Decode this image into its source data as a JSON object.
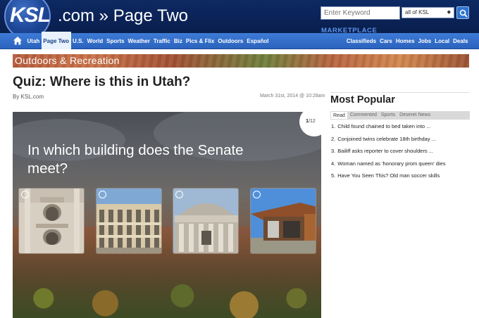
{
  "header": {
    "logo_main": "KSL",
    "logo_rest": ".com » Page Two",
    "search_placeholder": "Enter Keyword",
    "search_scope": "all of KSL",
    "marketplace_label": "MARKETPLACE"
  },
  "nav": {
    "items": [
      "Utah",
      "Page Two",
      "U.S.",
      "World",
      "Sports",
      "Weather",
      "Traffic",
      "Biz",
      "Pics & Flix",
      "Outdoors",
      "Español"
    ],
    "active_index": 1,
    "market_items": [
      "Classifieds",
      "Cars",
      "Homes",
      "Jobs",
      "Local",
      "Deals"
    ]
  },
  "banner": {
    "section": "Outdoors & Recreation"
  },
  "article": {
    "title": "Quiz: Where is this in Utah?",
    "byline": "By KSL.com",
    "date": "March 31st, 2014 @ 10:28am"
  },
  "quiz": {
    "question": "In which building does the Senate meet?",
    "counter_current": "1",
    "counter_total": "/12",
    "options": [
      "temple-window-photo",
      "modern-grid-building-photo",
      "capitol-columns-photo",
      "copper-modern-building-photo"
    ]
  },
  "sidebar": {
    "title": "Most Popular",
    "tabs": [
      "Read",
      "Commented",
      "Sports",
      "Deseret News"
    ],
    "items": [
      "Child found chained to bed taken into ...",
      "Conjoined twins celebrate 18th birthday ...",
      "Bailiff asks reporter to cover shoulders ...",
      "Woman named as 'honorary prom queen' dies",
      "Have You Seen This? Old man soccer skills"
    ]
  }
}
